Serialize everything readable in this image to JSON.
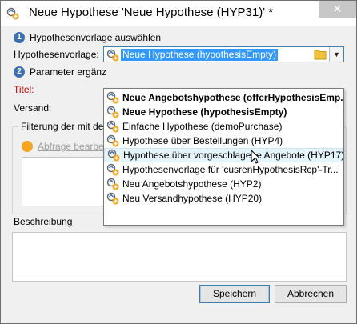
{
  "window": {
    "title": "Neue Hypothese 'Neue Hypothese (HYP31)' *",
    "close_label": "✕"
  },
  "steps": [
    {
      "number": "1",
      "label": "Hypothesenvorlage auswählen"
    },
    {
      "number": "2",
      "label": "Parameter ergänz"
    }
  ],
  "form": {
    "template_label": "Hypothesenvorlage:",
    "template_selected": "Neue Hypothese (hypothesisEmpty)",
    "title_label": "Titel:",
    "delivery_label": "Versand:"
  },
  "filter": {
    "group_title": "Filterung der mit de",
    "query_link": "Abfrage bearbe"
  },
  "description": {
    "group_title": "Beschreibung"
  },
  "buttons": {
    "save": "Speichern",
    "cancel": "Abbrechen"
  },
  "dropdown": {
    "items": [
      {
        "label": "Neue Angebotshypothese (offerHypothesisEmp...",
        "bold": true
      },
      {
        "label": "Neue Hypothese (hypothesisEmpty)",
        "bold": true
      },
      {
        "label": "Einfache Hypothese (demoPurchase)",
        "bold": false
      },
      {
        "label": "Hypothese über Bestellungen (HYP4)",
        "bold": false
      },
      {
        "label": "Hypothese über vorgeschlagene Angebote (HYP17)",
        "bold": false,
        "hovered": true
      },
      {
        "label": "Hypothesenvorlage für 'cusrenHypothesisRcp'-Tr...",
        "bold": false
      },
      {
        "label": "Neu Angebotshypothese (HYP2)",
        "bold": false
      },
      {
        "label": "Neu Versandhypothese (HYP20)",
        "bold": false
      }
    ]
  },
  "colors": {
    "accent": "#3399ff",
    "step_circle": "#3f6fb3",
    "required_label": "#c00000",
    "query_icon": "#f5a623"
  },
  "icons": {
    "title_icon": "hypothesis-icon",
    "template_icon": "hypothesis-icon",
    "folder_icon": "folder-icon",
    "dropdown_icon": "chevron-down-icon"
  }
}
